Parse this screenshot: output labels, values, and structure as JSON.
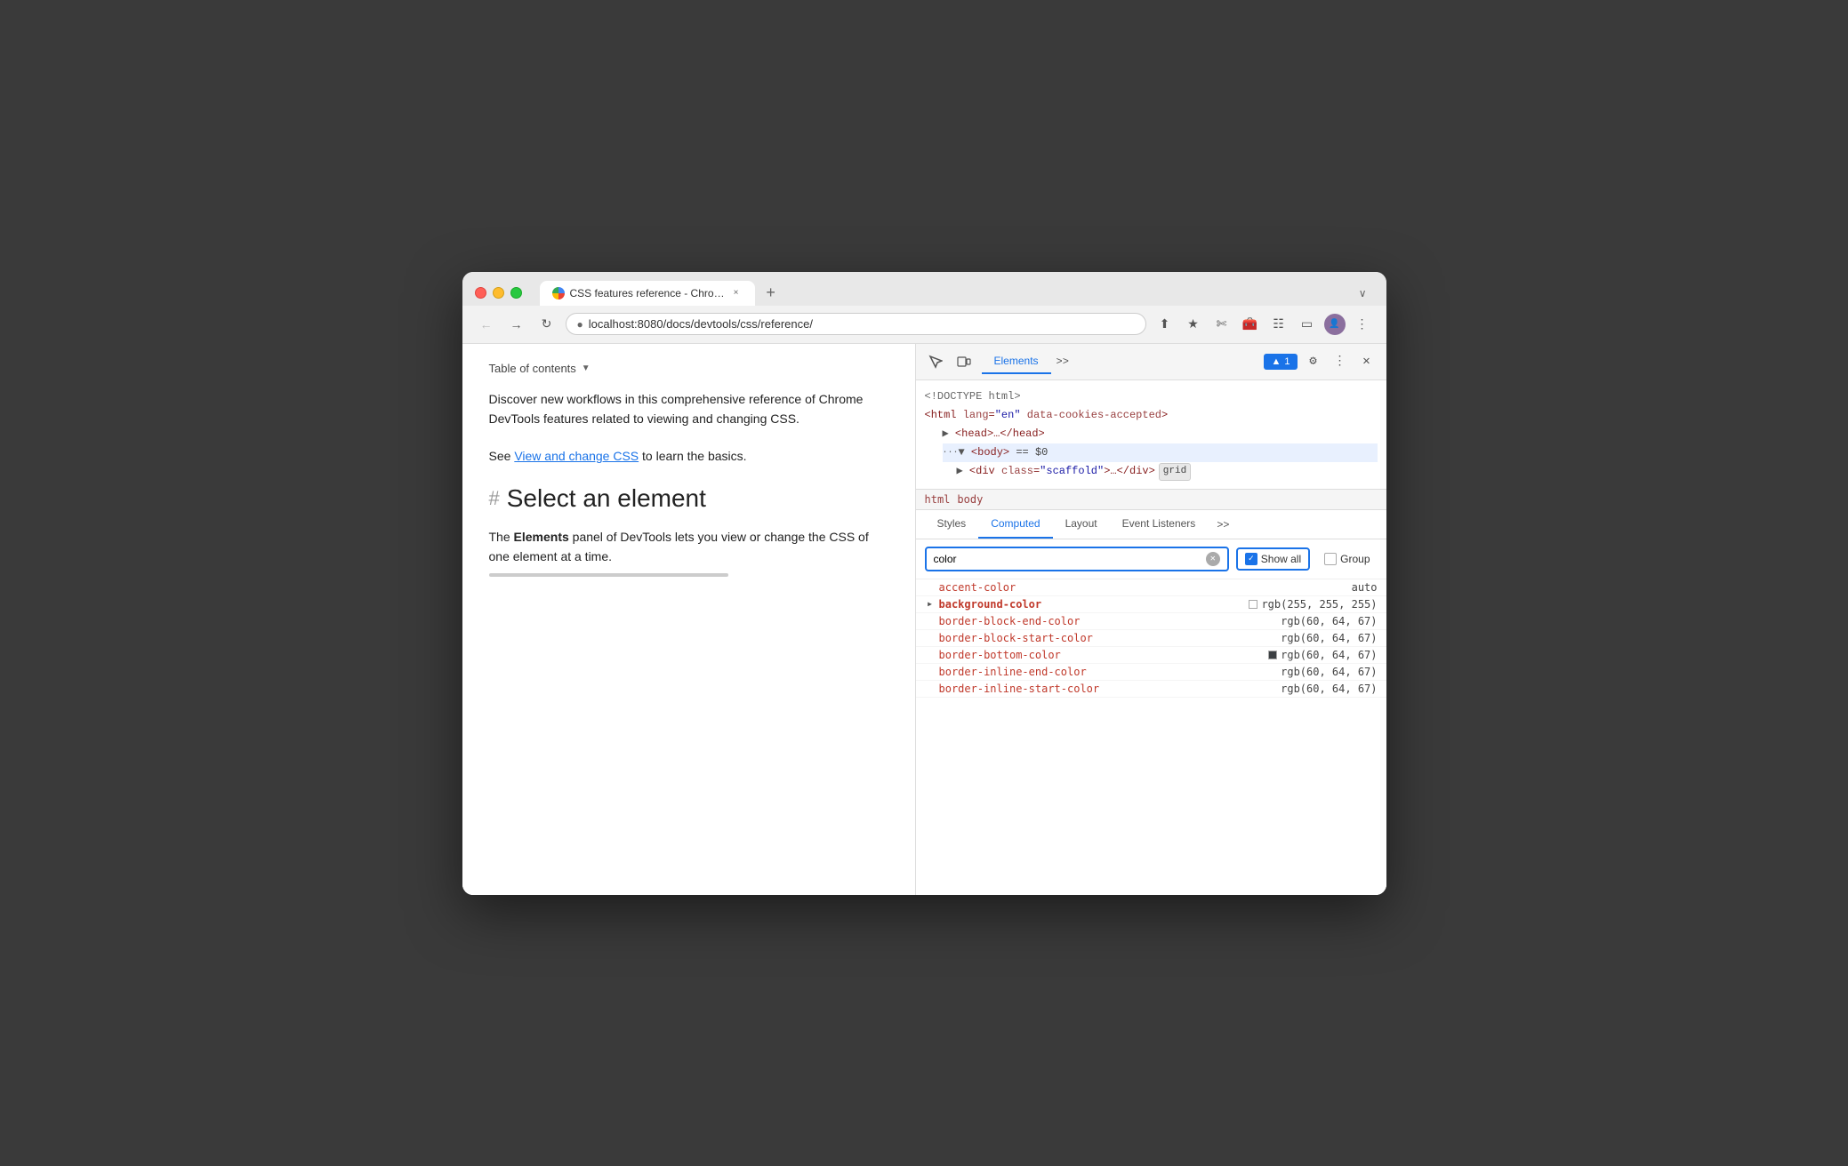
{
  "browser": {
    "tab_title": "CSS features reference - Chro…",
    "tab_close": "×",
    "new_tab": "+",
    "tab_menu": "∨",
    "url": "localhost:8080/docs/devtools/css/reference/",
    "nav_back": "←",
    "nav_forward": "→",
    "nav_reload": "↻"
  },
  "webpage": {
    "toc_label": "Table of contents",
    "description_1": "Discover new workflows in this comprehensive reference of Chrome DevTools features related to viewing and changing CSS.",
    "description_2_prefix": "See ",
    "description_link": "View and change CSS",
    "description_2_suffix": " to learn the basics.",
    "section_hash": "#",
    "section_title": "Select an element",
    "section_body_prefix": "The ",
    "section_body_bold": "Elements",
    "section_body_suffix": " panel of DevTools lets you view or change the CSS of one element at a time."
  },
  "devtools": {
    "tabs": [
      "Elements",
      ">>"
    ],
    "active_tab": "Elements",
    "toolbar_icons": [
      "cursor",
      "device",
      "settings",
      "more",
      "close"
    ],
    "badge_label": "1",
    "dom": {
      "line1": "<!DOCTYPE html>",
      "line2": "<html lang=\"en\" data-cookies-accepted>",
      "line3": "▶ <head>…</head>",
      "line4": "<body> == $0",
      "line5": "▶ <div class=\"scaffold\">…</div>",
      "line5_badge": "grid",
      "breadcrumb": [
        "html",
        "body"
      ]
    },
    "computed_tabs": [
      "Styles",
      "Computed",
      "Layout",
      "Event Listeners",
      ">>"
    ],
    "active_computed_tab": "Computed",
    "filter": {
      "placeholder": "color",
      "value": "color"
    },
    "show_all_checked": true,
    "show_all_label": "Show all",
    "group_label": "Group",
    "properties": [
      {
        "name": "accent-color",
        "value": "auto",
        "expandable": false,
        "bold": false,
        "swatch": null
      },
      {
        "name": "background-color",
        "value": "rgb(255, 255, 255)",
        "expandable": true,
        "bold": true,
        "swatch": "white"
      },
      {
        "name": "border-block-end-color",
        "value": "rgb(60, 64, 67)",
        "expandable": false,
        "bold": false,
        "swatch": null
      },
      {
        "name": "border-block-start-color",
        "value": "rgb(60, 64, 67)",
        "expandable": false,
        "bold": false,
        "swatch": null
      },
      {
        "name": "border-bottom-color",
        "value": "rgb(60, 64, 67)",
        "expandable": false,
        "bold": false,
        "swatch": "dark"
      },
      {
        "name": "border-inline-end-color",
        "value": "rgb(60, 64, 67)",
        "expandable": false,
        "bold": false,
        "swatch": null
      },
      {
        "name": "border-inline-start-color",
        "value": "rgb(60, 64, 67)",
        "expandable": false,
        "bold": false,
        "swatch": null
      }
    ]
  }
}
